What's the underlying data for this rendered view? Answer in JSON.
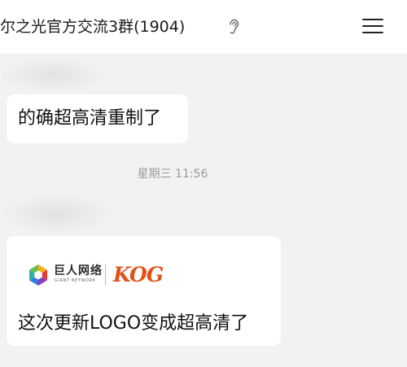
{
  "header": {
    "title": "尔之光官方交流3群(1904)",
    "ear_icon": "ear-icon",
    "menu_icon": "menu-icon"
  },
  "messages": [
    {
      "text": "的确超高清重制了"
    },
    {
      "logo": {
        "brand_cn": "巨人网络",
        "brand_en": "GIANT NETWORK",
        "brand2": "KOG"
      },
      "text": "这次更新LOGO变成超高清了"
    }
  ],
  "timestamp": "星期三 11:56",
  "colors": {
    "background": "#f2f2f2",
    "bubble": "#ffffff",
    "timestamp": "#9a9a9a",
    "kog_orange": "#e0521a"
  }
}
